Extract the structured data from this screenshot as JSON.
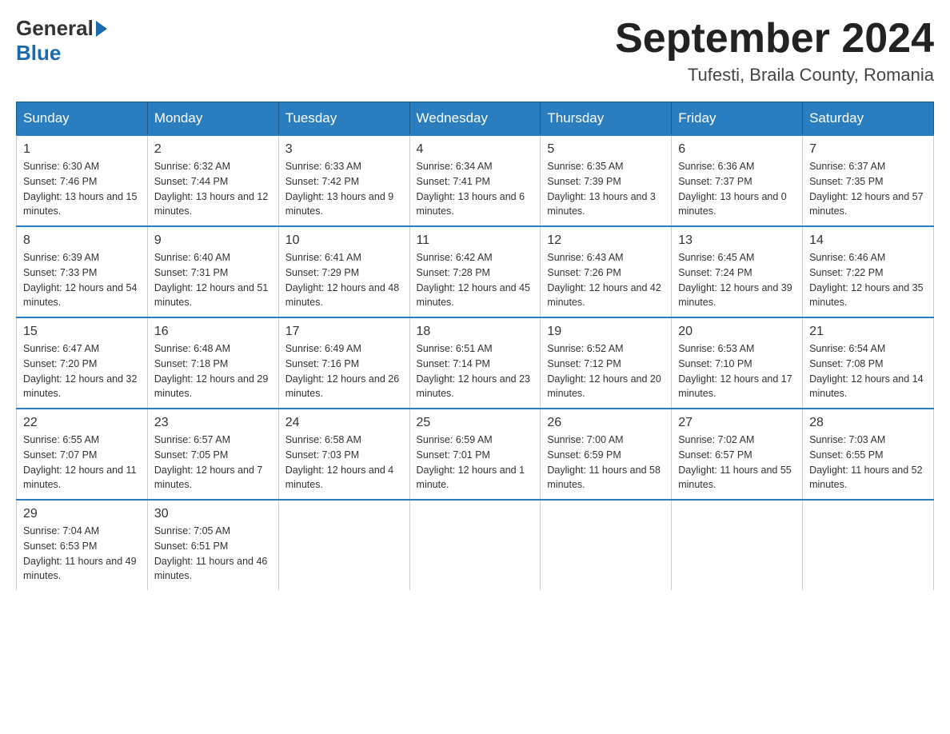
{
  "logo": {
    "general": "General",
    "blue": "Blue"
  },
  "title": "September 2024",
  "location": "Tufesti, Braila County, Romania",
  "days_of_week": [
    "Sunday",
    "Monday",
    "Tuesday",
    "Wednesday",
    "Thursday",
    "Friday",
    "Saturday"
  ],
  "weeks": [
    [
      {
        "day": "1",
        "sunrise": "6:30 AM",
        "sunset": "7:46 PM",
        "daylight": "13 hours and 15 minutes."
      },
      {
        "day": "2",
        "sunrise": "6:32 AM",
        "sunset": "7:44 PM",
        "daylight": "13 hours and 12 minutes."
      },
      {
        "day": "3",
        "sunrise": "6:33 AM",
        "sunset": "7:42 PM",
        "daylight": "13 hours and 9 minutes."
      },
      {
        "day": "4",
        "sunrise": "6:34 AM",
        "sunset": "7:41 PM",
        "daylight": "13 hours and 6 minutes."
      },
      {
        "day": "5",
        "sunrise": "6:35 AM",
        "sunset": "7:39 PM",
        "daylight": "13 hours and 3 minutes."
      },
      {
        "day": "6",
        "sunrise": "6:36 AM",
        "sunset": "7:37 PM",
        "daylight": "13 hours and 0 minutes."
      },
      {
        "day": "7",
        "sunrise": "6:37 AM",
        "sunset": "7:35 PM",
        "daylight": "12 hours and 57 minutes."
      }
    ],
    [
      {
        "day": "8",
        "sunrise": "6:39 AM",
        "sunset": "7:33 PM",
        "daylight": "12 hours and 54 minutes."
      },
      {
        "day": "9",
        "sunrise": "6:40 AM",
        "sunset": "7:31 PM",
        "daylight": "12 hours and 51 minutes."
      },
      {
        "day": "10",
        "sunrise": "6:41 AM",
        "sunset": "7:29 PM",
        "daylight": "12 hours and 48 minutes."
      },
      {
        "day": "11",
        "sunrise": "6:42 AM",
        "sunset": "7:28 PM",
        "daylight": "12 hours and 45 minutes."
      },
      {
        "day": "12",
        "sunrise": "6:43 AM",
        "sunset": "7:26 PM",
        "daylight": "12 hours and 42 minutes."
      },
      {
        "day": "13",
        "sunrise": "6:45 AM",
        "sunset": "7:24 PM",
        "daylight": "12 hours and 39 minutes."
      },
      {
        "day": "14",
        "sunrise": "6:46 AM",
        "sunset": "7:22 PM",
        "daylight": "12 hours and 35 minutes."
      }
    ],
    [
      {
        "day": "15",
        "sunrise": "6:47 AM",
        "sunset": "7:20 PM",
        "daylight": "12 hours and 32 minutes."
      },
      {
        "day": "16",
        "sunrise": "6:48 AM",
        "sunset": "7:18 PM",
        "daylight": "12 hours and 29 minutes."
      },
      {
        "day": "17",
        "sunrise": "6:49 AM",
        "sunset": "7:16 PM",
        "daylight": "12 hours and 26 minutes."
      },
      {
        "day": "18",
        "sunrise": "6:51 AM",
        "sunset": "7:14 PM",
        "daylight": "12 hours and 23 minutes."
      },
      {
        "day": "19",
        "sunrise": "6:52 AM",
        "sunset": "7:12 PM",
        "daylight": "12 hours and 20 minutes."
      },
      {
        "day": "20",
        "sunrise": "6:53 AM",
        "sunset": "7:10 PM",
        "daylight": "12 hours and 17 minutes."
      },
      {
        "day": "21",
        "sunrise": "6:54 AM",
        "sunset": "7:08 PM",
        "daylight": "12 hours and 14 minutes."
      }
    ],
    [
      {
        "day": "22",
        "sunrise": "6:55 AM",
        "sunset": "7:07 PM",
        "daylight": "12 hours and 11 minutes."
      },
      {
        "day": "23",
        "sunrise": "6:57 AM",
        "sunset": "7:05 PM",
        "daylight": "12 hours and 7 minutes."
      },
      {
        "day": "24",
        "sunrise": "6:58 AM",
        "sunset": "7:03 PM",
        "daylight": "12 hours and 4 minutes."
      },
      {
        "day": "25",
        "sunrise": "6:59 AM",
        "sunset": "7:01 PM",
        "daylight": "12 hours and 1 minute."
      },
      {
        "day": "26",
        "sunrise": "7:00 AM",
        "sunset": "6:59 PM",
        "daylight": "11 hours and 58 minutes."
      },
      {
        "day": "27",
        "sunrise": "7:02 AM",
        "sunset": "6:57 PM",
        "daylight": "11 hours and 55 minutes."
      },
      {
        "day": "28",
        "sunrise": "7:03 AM",
        "sunset": "6:55 PM",
        "daylight": "11 hours and 52 minutes."
      }
    ],
    [
      {
        "day": "29",
        "sunrise": "7:04 AM",
        "sunset": "6:53 PM",
        "daylight": "11 hours and 49 minutes."
      },
      {
        "day": "30",
        "sunrise": "7:05 AM",
        "sunset": "6:51 PM",
        "daylight": "11 hours and 46 minutes."
      },
      null,
      null,
      null,
      null,
      null
    ]
  ]
}
